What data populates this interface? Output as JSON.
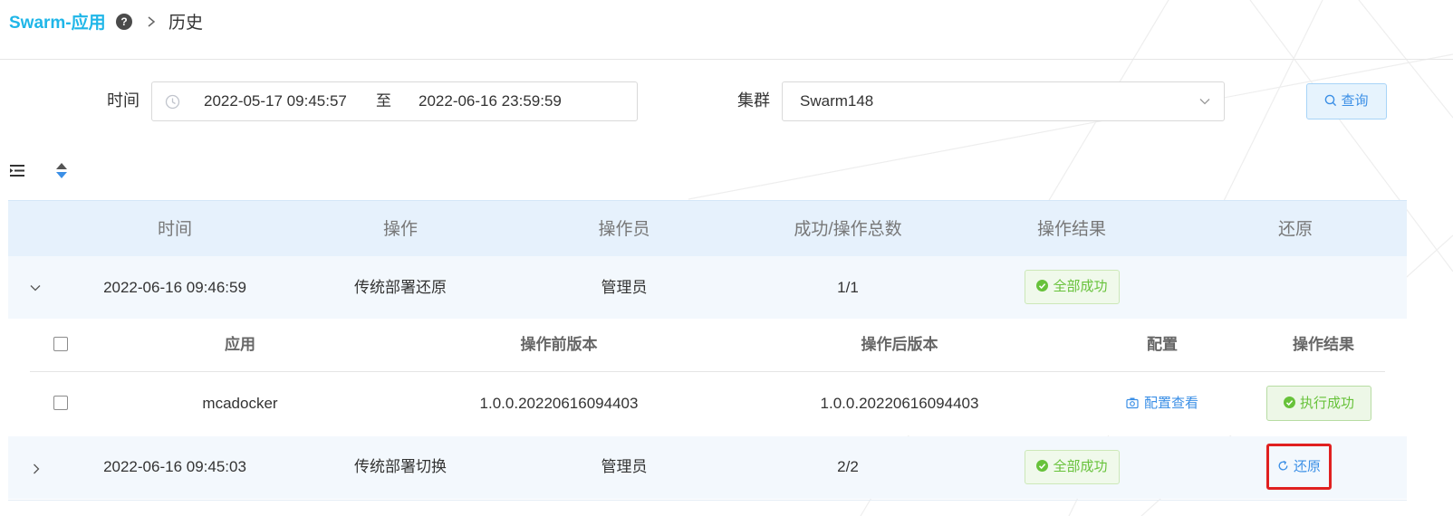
{
  "header": {
    "app_title": "Swarm-应用",
    "help_glyph": "?",
    "current_page": "历史"
  },
  "filters": {
    "time_label": "时间",
    "start_time": "2022-05-17 09:45:57",
    "range_separator": "至",
    "end_time": "2022-06-16 23:59:59",
    "cluster_label": "集群",
    "cluster_value": "Swarm148",
    "query_label": "查询"
  },
  "toolbar": {
    "list_icon": "list-indent-icon",
    "sort_icon": "sort-icon"
  },
  "history_table": {
    "columns": [
      "时间",
      "操作",
      "操作员",
      "成功/操作总数",
      "操作结果",
      "还原"
    ],
    "rows": [
      {
        "expanded": true,
        "time": "2022-06-16 09:46:59",
        "operation": "传统部署还原",
        "operator": "管理员",
        "count": "1/1",
        "result": "全部成功",
        "restore": ""
      },
      {
        "expanded": false,
        "time": "2022-06-16 09:45:03",
        "operation": "传统部署切换",
        "operator": "管理员",
        "count": "2/2",
        "result": "全部成功",
        "restore": "还原"
      }
    ]
  },
  "detail_table": {
    "columns": [
      "应用",
      "操作前版本",
      "操作后版本",
      "配置",
      "操作结果"
    ],
    "rows": [
      {
        "app": "mcadocker",
        "before_version": "1.0.0.20220616094403",
        "after_version": "1.0.0.20220616094403",
        "config_link": "配置查看",
        "result": "执行成功"
      }
    ]
  },
  "colors": {
    "brand": "#1fb6e8",
    "link": "#3b8fe6",
    "success": "#67c23a",
    "highlight_border": "#e02020",
    "table_header_bg": "#e6f1fc"
  }
}
